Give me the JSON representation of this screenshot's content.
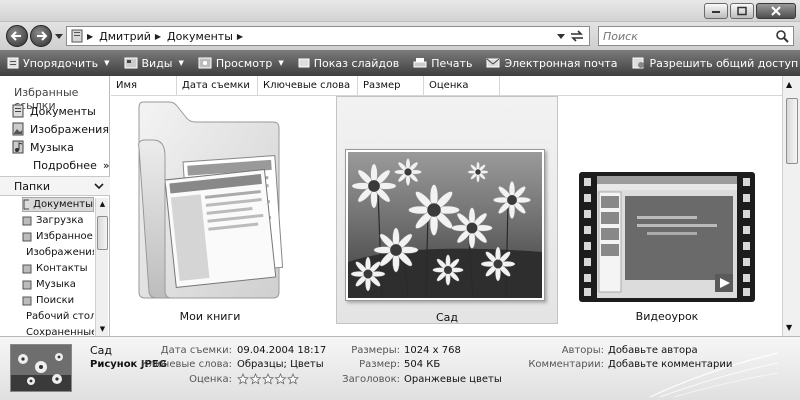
{
  "window": {
    "controls": {
      "minimize": "minimize",
      "maximize": "maximize",
      "close": "close"
    }
  },
  "address": {
    "crumbs": [
      "Дмитрий",
      "Документы"
    ],
    "search_placeholder": "Поиск"
  },
  "toolbar": {
    "items": [
      {
        "label": "Упорядочить",
        "icon": "organize-icon",
        "caret": true
      },
      {
        "label": "Виды",
        "icon": "views-icon",
        "caret": true
      },
      {
        "label": "Просмотр",
        "icon": "preview-icon",
        "caret": true
      },
      {
        "label": "Показ слайдов",
        "icon": "slideshow-icon",
        "caret": false
      },
      {
        "label": "Печать",
        "icon": "print-icon",
        "caret": false
      },
      {
        "label": "Электронная почта",
        "icon": "email-icon",
        "caret": false
      },
      {
        "label": "Разрешить общий доступ",
        "icon": "share-icon",
        "caret": false
      }
    ],
    "overflow": "»"
  },
  "nav": {
    "favorites_title": "Избранные ссылки",
    "favorites": [
      "Документы",
      "Изображения",
      "Музыка"
    ],
    "more": "Подробнее",
    "more_arrow": "»",
    "folders_title": "Папки",
    "folders": [
      "Документы",
      "Загрузка",
      "Избранное",
      "Изображения",
      "Контакты",
      "Музыка",
      "Поиски",
      "Рабочий стол",
      "Сохраненные"
    ]
  },
  "columns": [
    "Имя",
    "Дата съемки",
    "Ключевые слова",
    "Размер",
    "Оценка"
  ],
  "items": [
    {
      "label": "Мои книги",
      "kind": "folder"
    },
    {
      "label": "Сад",
      "kind": "image"
    },
    {
      "label": "Видеоурок",
      "kind": "video"
    }
  ],
  "details": {
    "name": "Сад",
    "type": "Рисунок JPEG",
    "date_label": "Дата съемки:",
    "date_value": "09.04.2004 18:17",
    "keywords_label": "Ключевые слова:",
    "keywords_value": "Образцы; Цветы",
    "rating_label": "Оценка:",
    "rating_value": 0,
    "rating_max": 5,
    "dims_label": "Размеры:",
    "dims_value": "1024 x 768",
    "size_label": "Размер:",
    "size_value": "504 КБ",
    "title_label": "Заголовок:",
    "title_value": "Оранжевые цветы",
    "authors_label": "Авторы:",
    "authors_value": "Добавьте автора",
    "comments_label": "Комментарии:",
    "comments_value": "Добавьте комментарии"
  }
}
